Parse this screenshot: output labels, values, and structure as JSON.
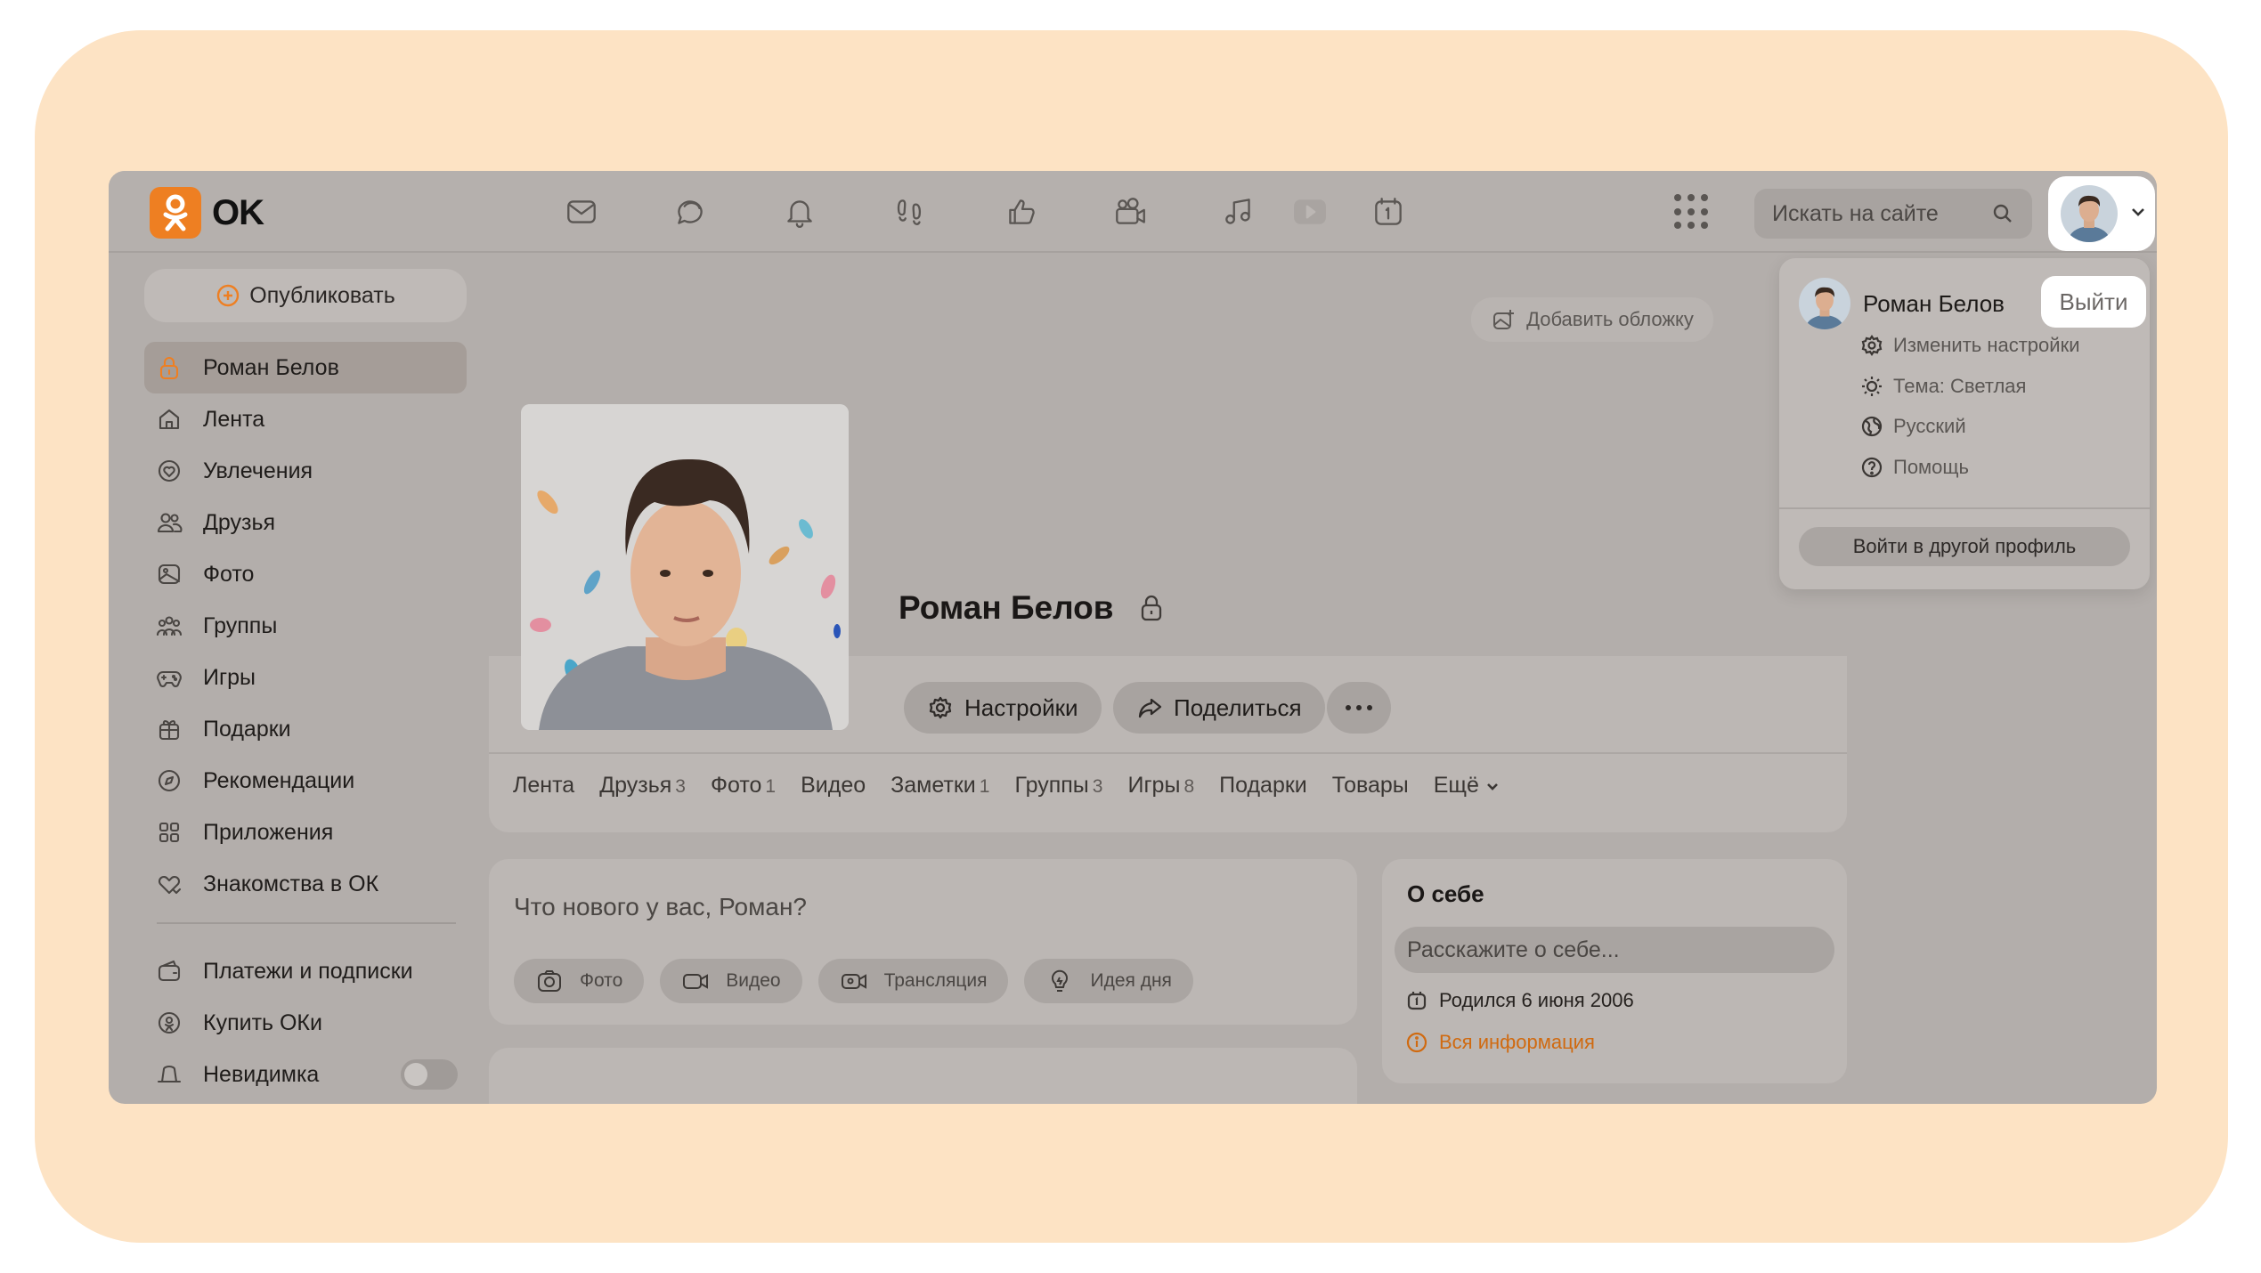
{
  "app": {
    "logo_text": "OK",
    "accent_color": "#ee7f22"
  },
  "header": {
    "nav_icons": [
      "mail-icon",
      "messages-icon",
      "bell-icon",
      "guests-icon",
      "like-icon",
      "video-camera-icon",
      "music-icon",
      "video-play-icon",
      "calendar-icon"
    ],
    "search_placeholder": "Искать на сайте"
  },
  "sidebar": {
    "publish_label": "Опубликовать",
    "items": [
      {
        "label": "Роман Белов",
        "icon": "lock-icon",
        "active": true
      },
      {
        "label": "Лента",
        "icon": "home-icon"
      },
      {
        "label": "Увлечения",
        "icon": "hobby-icon"
      },
      {
        "label": "Друзья",
        "icon": "friends-icon"
      },
      {
        "label": "Фото",
        "icon": "photo-icon"
      },
      {
        "label": "Группы",
        "icon": "groups-icon"
      },
      {
        "label": "Игры",
        "icon": "gamepad-icon"
      },
      {
        "label": "Подарки",
        "icon": "gift-icon"
      },
      {
        "label": "Рекомендации",
        "icon": "compass-icon"
      },
      {
        "label": "Приложения",
        "icon": "apps-icon"
      },
      {
        "label": "Знакомства в ОК",
        "icon": "dating-icon"
      }
    ],
    "bottom_items": [
      {
        "label": "Платежи и подписки",
        "icon": "wallet-icon"
      },
      {
        "label": "Купить ОКи",
        "icon": "coin-icon"
      },
      {
        "label": "Невидимка",
        "icon": "hat-icon",
        "toggle": false
      }
    ]
  },
  "profile": {
    "add_cover_label": "Добавить обложку",
    "name": "Роман Белов",
    "settings_label": "Настройки",
    "share_label": "Поделиться",
    "tabs": [
      {
        "label": "Лента",
        "count": ""
      },
      {
        "label": "Друзья",
        "count": "3"
      },
      {
        "label": "Фото",
        "count": "1"
      },
      {
        "label": "Видео",
        "count": ""
      },
      {
        "label": "Заметки",
        "count": "1"
      },
      {
        "label": "Группы",
        "count": "3"
      },
      {
        "label": "Игры",
        "count": "8"
      },
      {
        "label": "Подарки",
        "count": ""
      },
      {
        "label": "Товары",
        "count": ""
      },
      {
        "label": "Ещё",
        "count": ""
      }
    ]
  },
  "composer": {
    "placeholder": "Что нового у вас, Роман?",
    "actions": [
      "Фото",
      "Видео",
      "Трансляция",
      "Идея дня"
    ]
  },
  "about": {
    "title": "О себе",
    "input_placeholder": "Расскажите о себе...",
    "birthday": "Родился 6 июня 2006",
    "all_info_label": "Вся информация"
  },
  "dropdown": {
    "user_name": "Роман Белов",
    "logout_label": "Выйти",
    "items": [
      {
        "label": "Изменить настройки",
        "icon": "gear-icon"
      },
      {
        "label": "Тема: Светлая",
        "icon": "sun-icon"
      },
      {
        "label": "Русский",
        "icon": "globe-icon"
      },
      {
        "label": "Помощь",
        "icon": "help-icon"
      }
    ],
    "switch_profile_label": "Войти в другой профиль"
  }
}
